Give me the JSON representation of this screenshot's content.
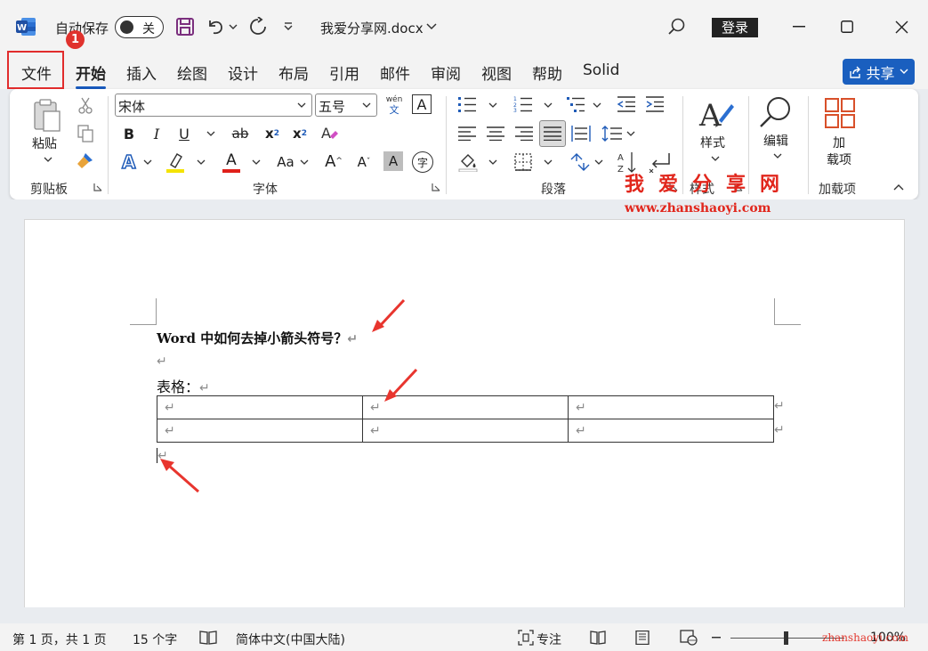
{
  "titlebar": {
    "autosave_label": "自动保存",
    "autosave_state": "关",
    "doc_title": "我爱分享网.docx",
    "login": "登录",
    "badge": "1"
  },
  "tabs": [
    "文件",
    "开始",
    "插入",
    "绘图",
    "设计",
    "布局",
    "引用",
    "邮件",
    "审阅",
    "视图",
    "帮助",
    "Solid"
  ],
  "share": {
    "label": "共享"
  },
  "ribbon": {
    "clipboard": {
      "paste": "粘贴",
      "label": "剪贴板"
    },
    "font": {
      "family": "宋体",
      "size": "五号",
      "phonetic_top": "wén",
      "phonetic_bottom": "文",
      "bold": "B",
      "italic": "I",
      "underline": "U",
      "strike": "ab",
      "subscript": "x",
      "sub_mark": "2",
      "superscript": "x",
      "sup_mark": "2",
      "text_effect": "A",
      "font_color": "A",
      "case": "Aa",
      "grow": "A",
      "shrink": "A",
      "shade": "A",
      "enclose": "字",
      "label": "字体"
    },
    "paragraph": {
      "label": "段落"
    },
    "styles": {
      "button": "样式",
      "label": "样式"
    },
    "editing": {
      "button": "编辑"
    },
    "addins": {
      "button_line1": "加",
      "button_line2": "载项",
      "label": "加载项"
    }
  },
  "document": {
    "heading": "Word 中如何去掉小箭头符号？",
    "para_mark": "↵",
    "table_label": "表格：",
    "table_rows": [
      [
        "↵",
        "↵",
        "↵"
      ],
      [
        "↵",
        "↵",
        "↵"
      ]
    ]
  },
  "watermark": {
    "site_cn": "我爱分享网",
    "site_url": "www.zhanshaoyi.com",
    "site_url_short": "zhanshaoyi.com"
  },
  "statusbar": {
    "page": "第 1 页，共 1 页",
    "words": "15 个字",
    "language": "简体中文(中国大陆)",
    "focus": "专注",
    "zoom": "100%"
  },
  "colors": {
    "accent": "#185abd",
    "share": "#1a5fbf",
    "annotation": "#e12c2c",
    "watermark": "#e1261c"
  }
}
